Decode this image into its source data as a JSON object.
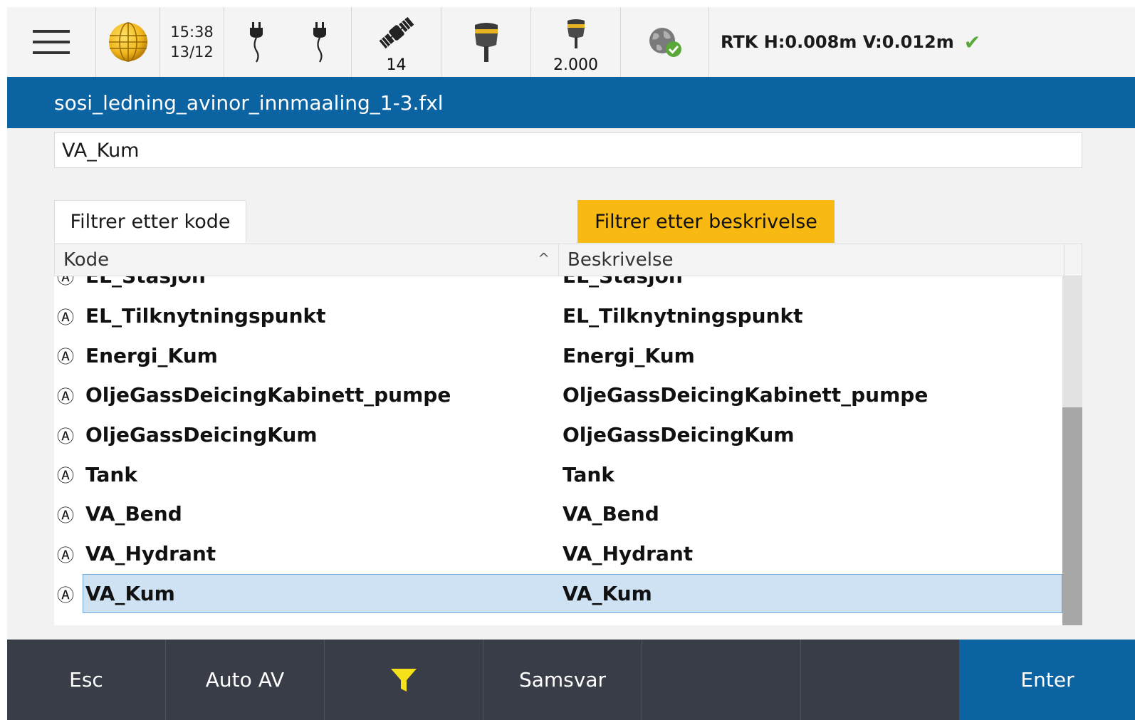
{
  "statusbar": {
    "menu_icon": "hamburger-menu-icon",
    "globe_icon": "globe-icon",
    "time": "15:38",
    "date": "13/12",
    "power_icons": [
      "power-plug-icon",
      "power-plug-icon"
    ],
    "satellite_count": "14",
    "receiver_icon": "gnss-receiver-icon",
    "antenna_height": "2.000",
    "network_icon": "network-globe-check-icon",
    "rtk_status": "RTK H:0.008m V:0.012m",
    "rtk_ok_icon": "checkmark-icon"
  },
  "title": "sosi_ledning_avinor_innmaaling_1-3.fxl",
  "search": {
    "value": "VA_Kum"
  },
  "filters": {
    "by_code": "Filtrer etter kode",
    "by_description": "Filtrer etter beskrivelse"
  },
  "table": {
    "headers": {
      "code": "Kode",
      "description": "Beskrivelse"
    },
    "rows": [
      {
        "code": "EL_Stasjon",
        "description": "EL_Stasjon"
      },
      {
        "code": "EL_Tilknytningspunkt",
        "description": "EL_Tilknytningspunkt"
      },
      {
        "code": "Energi_Kum",
        "description": "Energi_Kum"
      },
      {
        "code": "OljeGassDeicingKabinett_pumpe",
        "description": "OljeGassDeicingKabinett_pumpe"
      },
      {
        "code": "OljeGassDeicingKum",
        "description": "OljeGassDeicingKum"
      },
      {
        "code": "Tank",
        "description": "Tank"
      },
      {
        "code": "VA_Bend",
        "description": "VA_Bend"
      },
      {
        "code": "VA_Hydrant",
        "description": "VA_Hydrant"
      },
      {
        "code": "VA_Kum",
        "description": "VA_Kum",
        "selected": true
      }
    ]
  },
  "bottombar": {
    "esc": "Esc",
    "auto": "Auto AV",
    "filter_icon": "filter-funnel-icon",
    "match": "Samsvar",
    "enter": "Enter"
  },
  "colors": {
    "accent_blue": "#0b63a2",
    "filter_active": "#f9b913",
    "selection": "#cfe2f3",
    "bottom_bar": "#393d47"
  }
}
